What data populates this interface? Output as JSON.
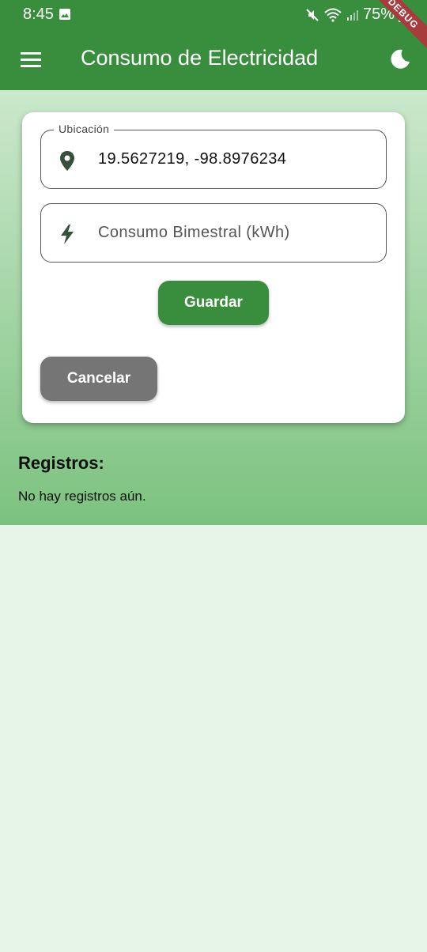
{
  "status_bar": {
    "time": "8:45",
    "battery": "75%",
    "icons": [
      "gallery-icon",
      "mute-icon",
      "wifi-icon",
      "signal-icon",
      "battery-icon"
    ]
  },
  "app_bar": {
    "title": "Consumo de Electricidad",
    "menu_icon": "menu-icon",
    "theme_icon": "dark-mode-icon",
    "debug_banner": "DEBUG",
    "color": "#388e3c"
  },
  "form": {
    "location": {
      "label": "Ubicación",
      "value": "19.5627219, -98.8976234",
      "icon": "location-pin-icon"
    },
    "consumption": {
      "placeholder": "Consumo Bimestral (kWh)",
      "icon": "lightning-icon"
    },
    "save_label": "Guardar",
    "cancel_label": "Cancelar"
  },
  "records": {
    "title": "Registros:",
    "empty_text": "No hay registros aún."
  },
  "colors": {
    "primary": "#388e3c",
    "cancel": "#757575",
    "background": "#e7f4e8"
  }
}
